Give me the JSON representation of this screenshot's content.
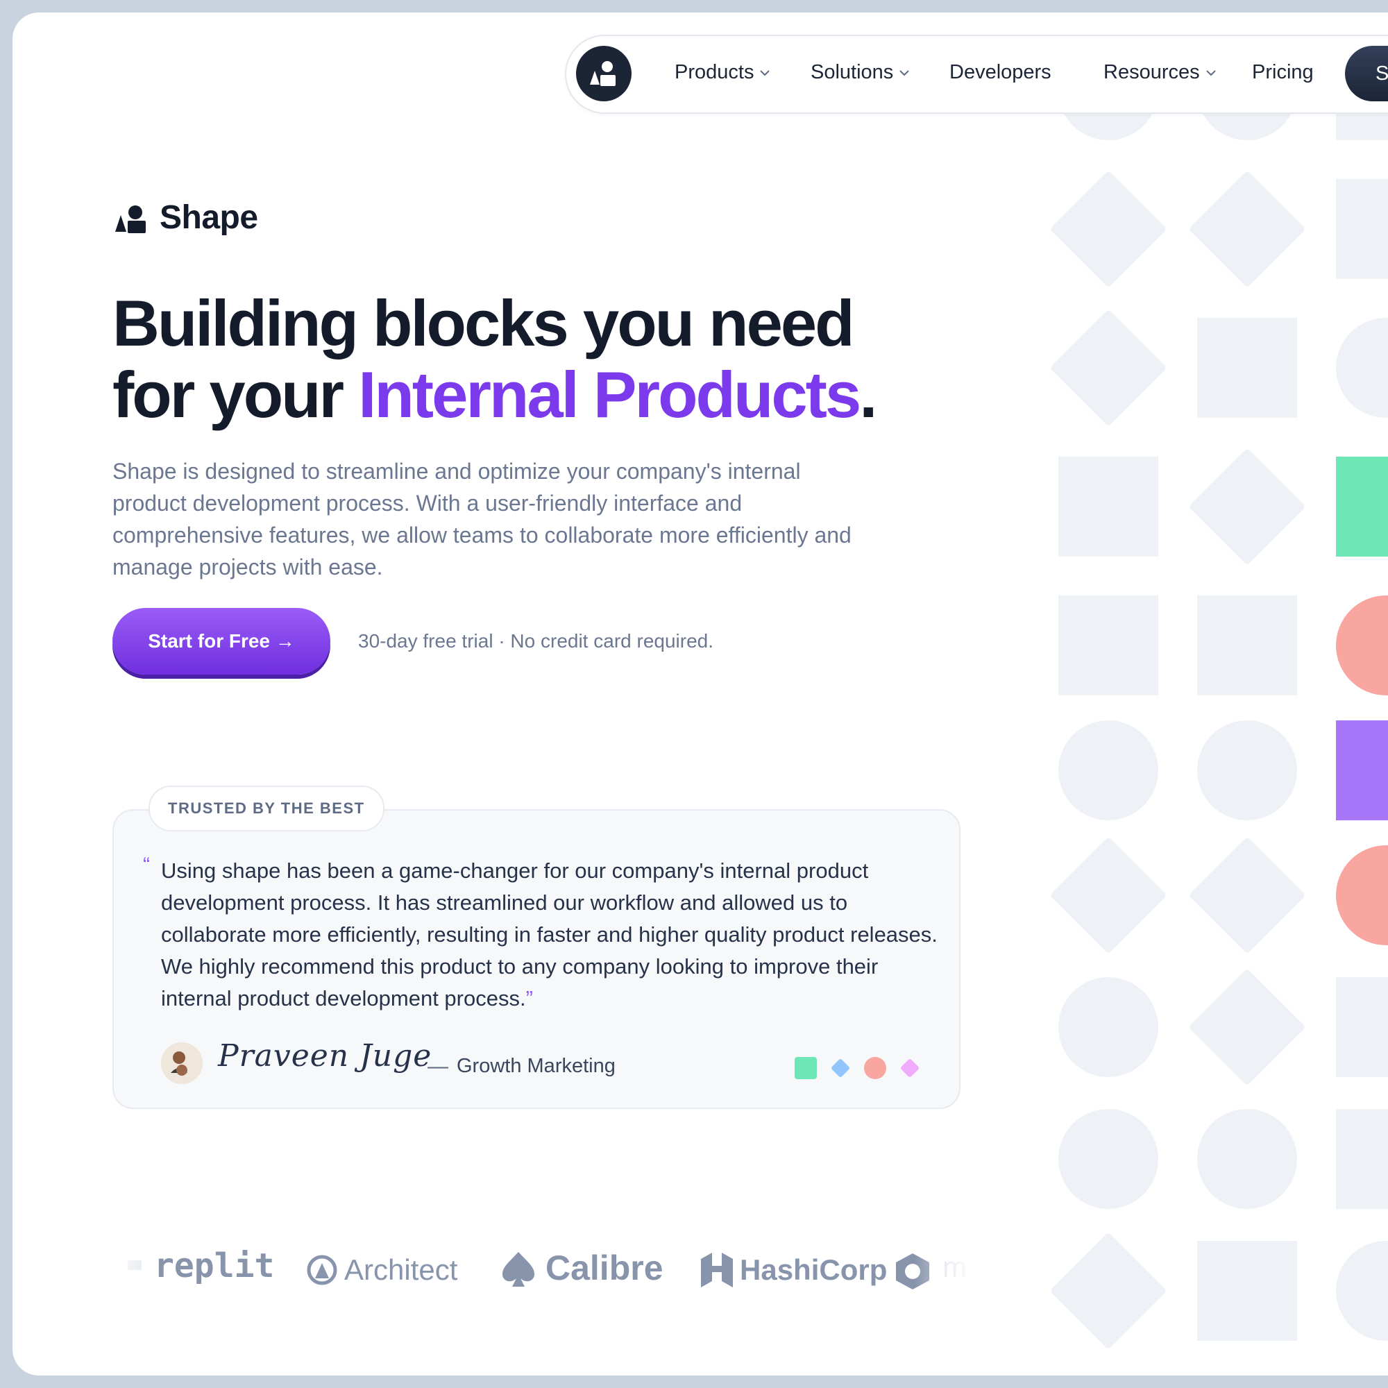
{
  "nav": {
    "items": [
      {
        "label": "Products",
        "has_dropdown": true
      },
      {
        "label": "Solutions",
        "has_dropdown": true
      },
      {
        "label": "Developers",
        "has_dropdown": false
      },
      {
        "label": "Resources",
        "has_dropdown": true
      },
      {
        "label": "Pricing",
        "has_dropdown": false
      }
    ],
    "cta_label": "S"
  },
  "brand": {
    "name": "Shape"
  },
  "hero": {
    "headline_line1": "Building blocks you need",
    "headline_line2_prefix": "for your ",
    "headline_accent": "Internal Products",
    "headline_suffix": ".",
    "description": "Shape is designed to streamline and optimize your company's internal product development process. With a user-friendly interface and comprehensive features, we allow teams to collaborate more efficiently and manage projects with ease.",
    "cta_label": "Start for Free →",
    "cta_note": "30-day free trial · No credit card required."
  },
  "testimonial": {
    "badge": "TRUSTED BY THE BEST",
    "open_quote": "“",
    "quote": "Using shape has been a game-changer for our company's internal product development process. It has streamlined our workflow and allowed us to collaborate more efficiently, resulting in faster and higher quality product releases. We highly recommend this product to any company looking to improve their internal product development process.",
    "close_quote": "”",
    "author_signature": "Praveen Juge",
    "dash": "—",
    "author_role": "Growth Marketing"
  },
  "logos": [
    "replit",
    "Architect",
    "Calibre",
    "HashiCorp",
    "m"
  ],
  "colors": {
    "accent": "#7c3aed",
    "dark": "#141b2b",
    "muted_text": "#6b7790",
    "shape_fill": "#eef2f7",
    "green": "#6ee7b7",
    "coral": "#f9a5a0",
    "violet": "#a876fb",
    "blue": "#93c5fd",
    "pink": "#f0abfc"
  }
}
